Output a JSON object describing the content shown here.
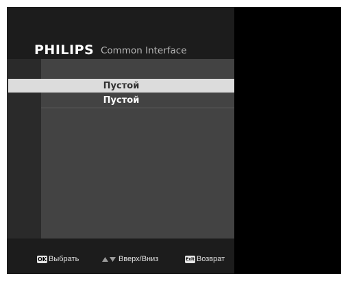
{
  "header": {
    "brand": "PHILIPS",
    "title": "Common Interface"
  },
  "menu": {
    "items": [
      {
        "label": "Пустой",
        "selected": true
      },
      {
        "label": "Пустой",
        "selected": false
      }
    ]
  },
  "footer": {
    "select": {
      "key": "OK",
      "label": "Выбрать",
      "icon": "ok-key-icon"
    },
    "navigate": {
      "label": "Вверх/Вниз",
      "icon": "up-down-arrows-icon"
    },
    "back": {
      "key": "Exit",
      "label": "Возврат",
      "icon": "exit-key-icon"
    }
  },
  "colors": {
    "background": "#000000",
    "panel": "#1c1c1c",
    "content": "#434343",
    "selected_row": "#dcdcdc",
    "text": "#ffffff"
  }
}
